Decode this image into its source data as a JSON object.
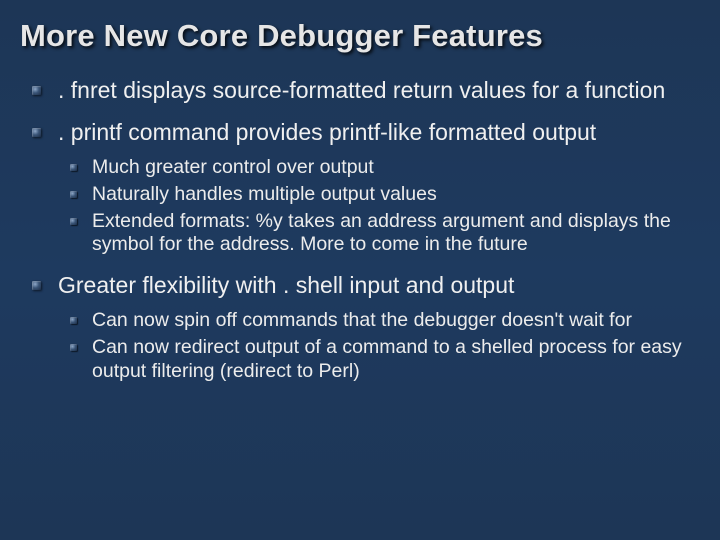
{
  "title": "More New Core Debugger Features",
  "bullets": [
    {
      "text": ". fnret displays source-formatted return values for a function",
      "sub": []
    },
    {
      "text": ". printf command provides printf-like formatted output",
      "sub": [
        "Much greater control over output",
        "Naturally handles multiple output values",
        "Extended formats: %y takes an address argument and displays the symbol for the address.  More to come in the future"
      ]
    },
    {
      "text": "Greater flexibility with . shell input and output",
      "sub": [
        "Can now spin off commands that the debugger doesn't wait for",
        "Can now redirect output of a command to a shelled process for easy output filtering (redirect to Perl)"
      ]
    }
  ]
}
